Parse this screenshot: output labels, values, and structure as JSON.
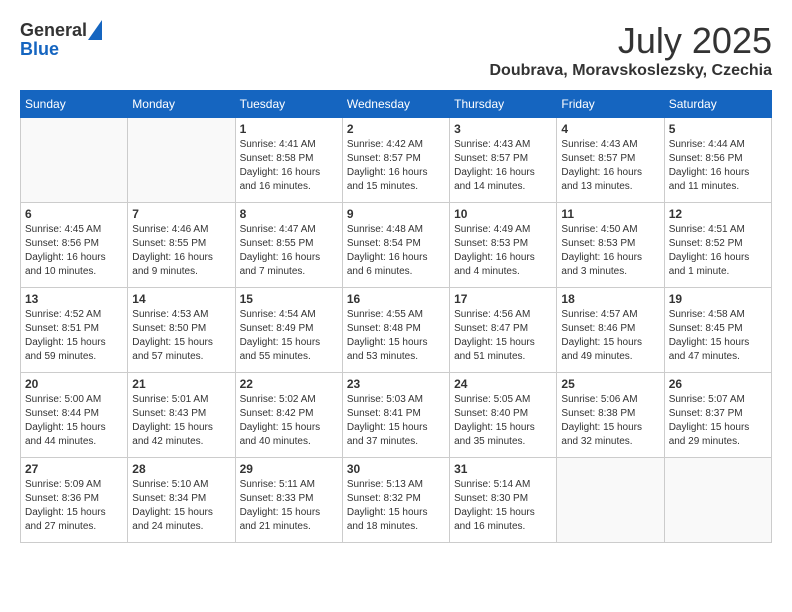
{
  "header": {
    "logo_general": "General",
    "logo_blue": "Blue",
    "month_year": "July 2025",
    "location": "Doubrava, Moravskoslezsky, Czechia"
  },
  "calendar": {
    "weekdays": [
      "Sunday",
      "Monday",
      "Tuesday",
      "Wednesday",
      "Thursday",
      "Friday",
      "Saturday"
    ],
    "weeks": [
      [
        {
          "day": "",
          "info": ""
        },
        {
          "day": "",
          "info": ""
        },
        {
          "day": "1",
          "info": "Sunrise: 4:41 AM\nSunset: 8:58 PM\nDaylight: 16 hours and 16 minutes."
        },
        {
          "day": "2",
          "info": "Sunrise: 4:42 AM\nSunset: 8:57 PM\nDaylight: 16 hours and 15 minutes."
        },
        {
          "day": "3",
          "info": "Sunrise: 4:43 AM\nSunset: 8:57 PM\nDaylight: 16 hours and 14 minutes."
        },
        {
          "day": "4",
          "info": "Sunrise: 4:43 AM\nSunset: 8:57 PM\nDaylight: 16 hours and 13 minutes."
        },
        {
          "day": "5",
          "info": "Sunrise: 4:44 AM\nSunset: 8:56 PM\nDaylight: 16 hours and 11 minutes."
        }
      ],
      [
        {
          "day": "6",
          "info": "Sunrise: 4:45 AM\nSunset: 8:56 PM\nDaylight: 16 hours and 10 minutes."
        },
        {
          "day": "7",
          "info": "Sunrise: 4:46 AM\nSunset: 8:55 PM\nDaylight: 16 hours and 9 minutes."
        },
        {
          "day": "8",
          "info": "Sunrise: 4:47 AM\nSunset: 8:55 PM\nDaylight: 16 hours and 7 minutes."
        },
        {
          "day": "9",
          "info": "Sunrise: 4:48 AM\nSunset: 8:54 PM\nDaylight: 16 hours and 6 minutes."
        },
        {
          "day": "10",
          "info": "Sunrise: 4:49 AM\nSunset: 8:53 PM\nDaylight: 16 hours and 4 minutes."
        },
        {
          "day": "11",
          "info": "Sunrise: 4:50 AM\nSunset: 8:53 PM\nDaylight: 16 hours and 3 minutes."
        },
        {
          "day": "12",
          "info": "Sunrise: 4:51 AM\nSunset: 8:52 PM\nDaylight: 16 hours and 1 minute."
        }
      ],
      [
        {
          "day": "13",
          "info": "Sunrise: 4:52 AM\nSunset: 8:51 PM\nDaylight: 15 hours and 59 minutes."
        },
        {
          "day": "14",
          "info": "Sunrise: 4:53 AM\nSunset: 8:50 PM\nDaylight: 15 hours and 57 minutes."
        },
        {
          "day": "15",
          "info": "Sunrise: 4:54 AM\nSunset: 8:49 PM\nDaylight: 15 hours and 55 minutes."
        },
        {
          "day": "16",
          "info": "Sunrise: 4:55 AM\nSunset: 8:48 PM\nDaylight: 15 hours and 53 minutes."
        },
        {
          "day": "17",
          "info": "Sunrise: 4:56 AM\nSunset: 8:47 PM\nDaylight: 15 hours and 51 minutes."
        },
        {
          "day": "18",
          "info": "Sunrise: 4:57 AM\nSunset: 8:46 PM\nDaylight: 15 hours and 49 minutes."
        },
        {
          "day": "19",
          "info": "Sunrise: 4:58 AM\nSunset: 8:45 PM\nDaylight: 15 hours and 47 minutes."
        }
      ],
      [
        {
          "day": "20",
          "info": "Sunrise: 5:00 AM\nSunset: 8:44 PM\nDaylight: 15 hours and 44 minutes."
        },
        {
          "day": "21",
          "info": "Sunrise: 5:01 AM\nSunset: 8:43 PM\nDaylight: 15 hours and 42 minutes."
        },
        {
          "day": "22",
          "info": "Sunrise: 5:02 AM\nSunset: 8:42 PM\nDaylight: 15 hours and 40 minutes."
        },
        {
          "day": "23",
          "info": "Sunrise: 5:03 AM\nSunset: 8:41 PM\nDaylight: 15 hours and 37 minutes."
        },
        {
          "day": "24",
          "info": "Sunrise: 5:05 AM\nSunset: 8:40 PM\nDaylight: 15 hours and 35 minutes."
        },
        {
          "day": "25",
          "info": "Sunrise: 5:06 AM\nSunset: 8:38 PM\nDaylight: 15 hours and 32 minutes."
        },
        {
          "day": "26",
          "info": "Sunrise: 5:07 AM\nSunset: 8:37 PM\nDaylight: 15 hours and 29 minutes."
        }
      ],
      [
        {
          "day": "27",
          "info": "Sunrise: 5:09 AM\nSunset: 8:36 PM\nDaylight: 15 hours and 27 minutes."
        },
        {
          "day": "28",
          "info": "Sunrise: 5:10 AM\nSunset: 8:34 PM\nDaylight: 15 hours and 24 minutes."
        },
        {
          "day": "29",
          "info": "Sunrise: 5:11 AM\nSunset: 8:33 PM\nDaylight: 15 hours and 21 minutes."
        },
        {
          "day": "30",
          "info": "Sunrise: 5:13 AM\nSunset: 8:32 PM\nDaylight: 15 hours and 18 minutes."
        },
        {
          "day": "31",
          "info": "Sunrise: 5:14 AM\nSunset: 8:30 PM\nDaylight: 15 hours and 16 minutes."
        },
        {
          "day": "",
          "info": ""
        },
        {
          "day": "",
          "info": ""
        }
      ]
    ]
  }
}
